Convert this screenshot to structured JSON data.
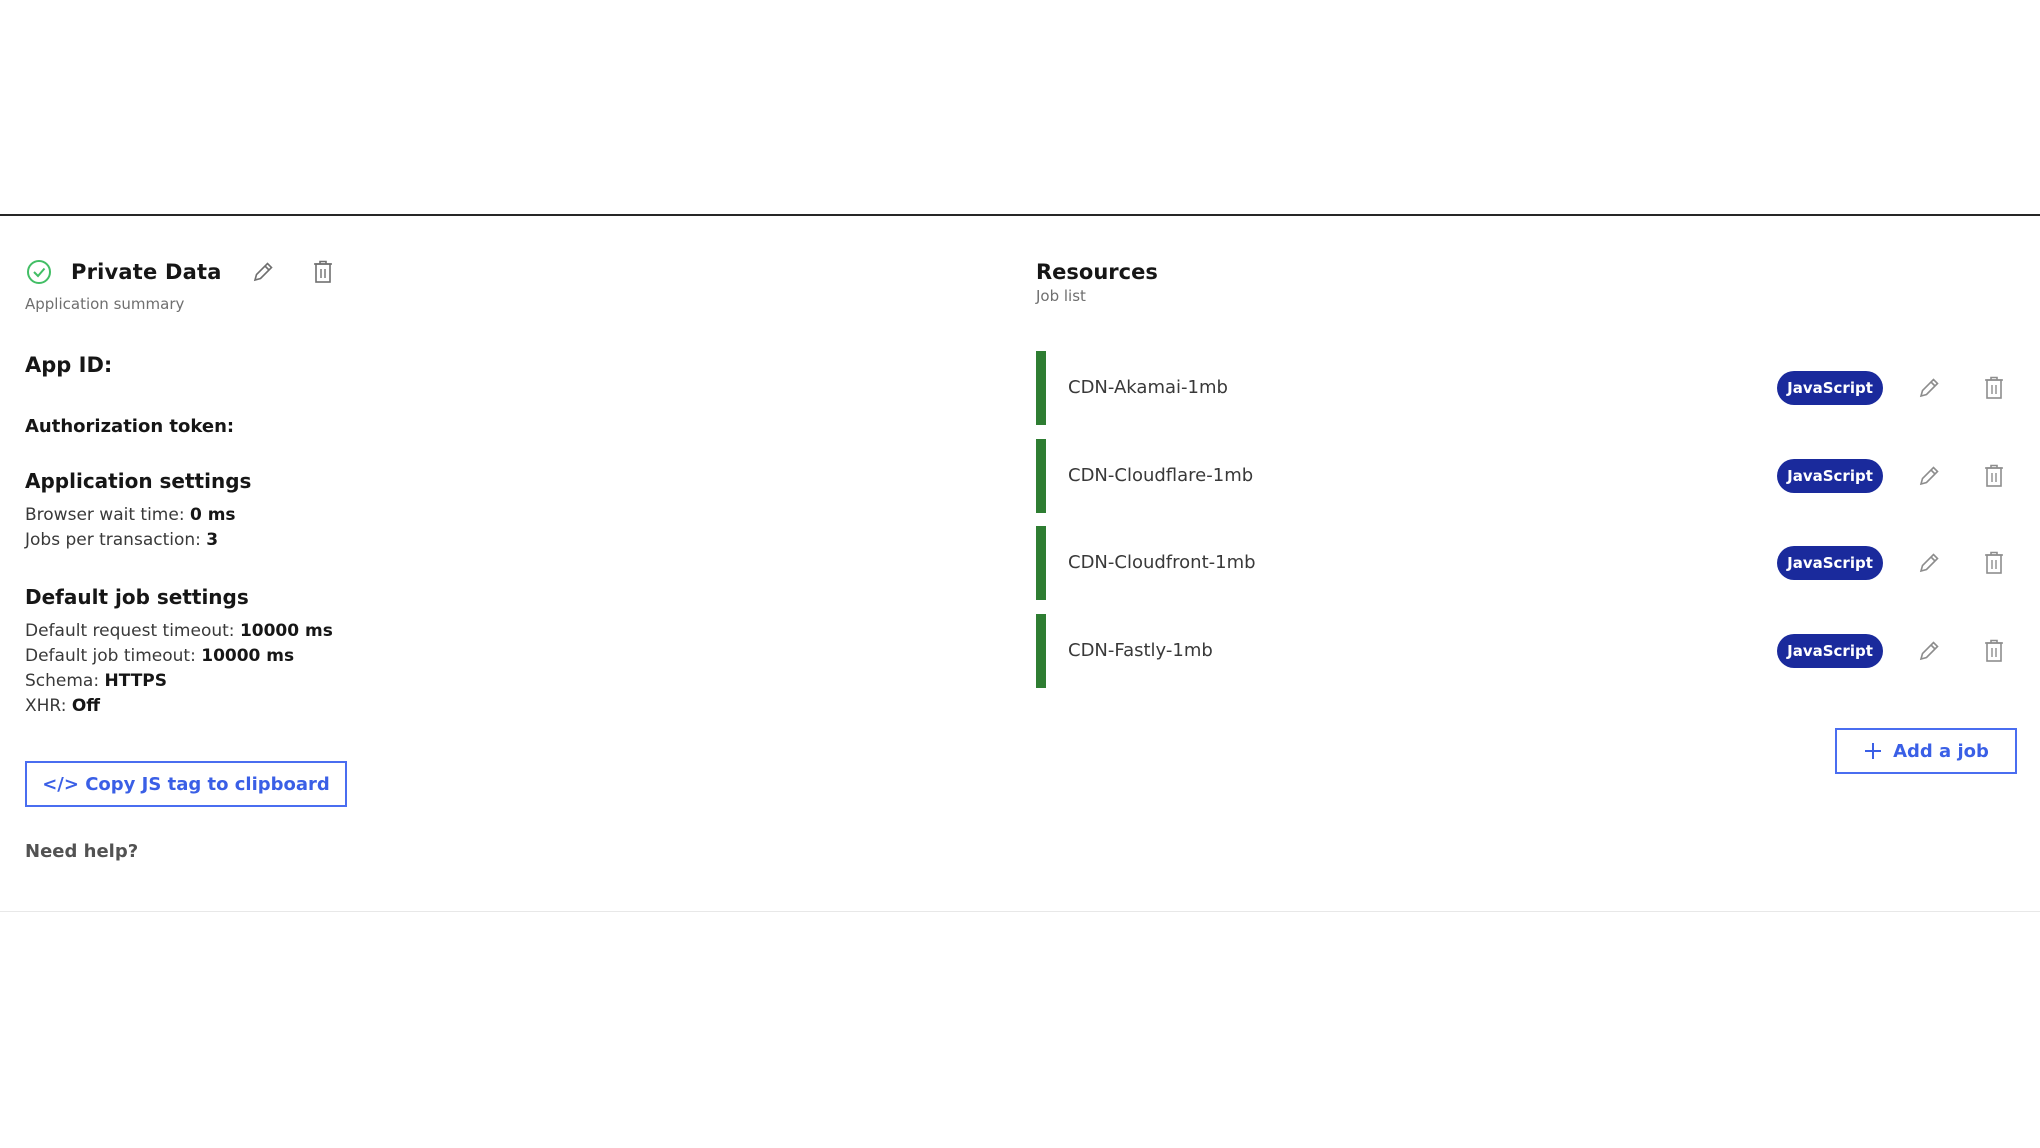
{
  "app": {
    "title": "Private Data",
    "subtitle": "Application summary",
    "app_id_label": "App ID:",
    "token_label": "Authorization token:",
    "application_settings": {
      "title": "Application settings",
      "browser_wait_label": "Browser wait time:",
      "browser_wait_value": "0 ms",
      "jobs_per_tx_label": "Jobs per transaction:",
      "jobs_per_tx_value": "3"
    },
    "default_job_settings": {
      "title": "Default job settings",
      "request_timeout_label": "Default request timeout:",
      "request_timeout_value": "10000 ms",
      "job_timeout_label": "Default job timeout:",
      "job_timeout_value": "10000 ms",
      "schema_label": "Schema:",
      "schema_value": "HTTPS",
      "xhr_label": "XHR:",
      "xhr_value": "Off"
    },
    "copy_button_label": "</> Copy JS tag to clipboard",
    "need_help": "Need help?"
  },
  "resources": {
    "title": "Resources",
    "subtitle": "Job list",
    "jobs": [
      {
        "name": "CDN-Akamai-1mb",
        "badge": "JavaScript"
      },
      {
        "name": "CDN-Cloudflare-1mb",
        "badge": "JavaScript"
      },
      {
        "name": "CDN-Cloudfront-1mb",
        "badge": "JavaScript"
      },
      {
        "name": "CDN-Fastly-1mb",
        "badge": "JavaScript"
      }
    ],
    "add_button_label": "Add a job"
  },
  "icons": {
    "status": "check-circle-icon",
    "edit": "pencil-icon",
    "delete": "trash-icon",
    "add": "plus-icon"
  },
  "colors": {
    "accent": "#3a5fe6",
    "badge": "#1a2a9c",
    "job_bar": "#2e7d32",
    "success": "#42be65"
  }
}
